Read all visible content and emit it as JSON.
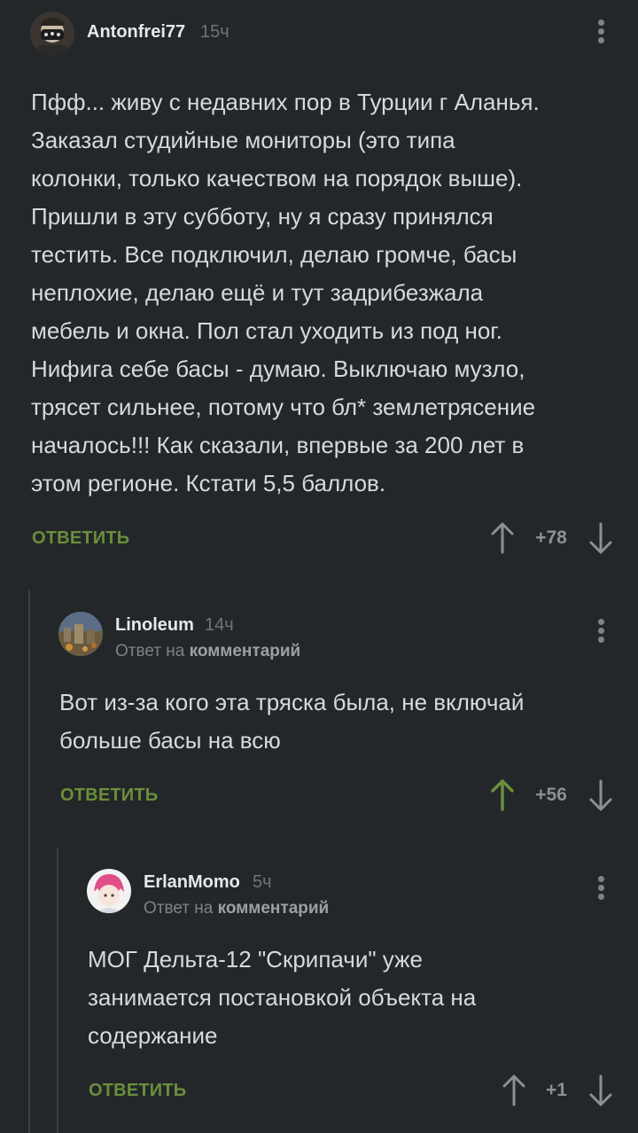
{
  "comments": [
    {
      "author": "Antonfrei77",
      "time": "15ч",
      "lines": [
        "Пфф... живу с недавних пор в Турции г Аланья.",
        "Заказал студийные мониторы (это типа",
        "колонки, только качеством на порядок выше).",
        "Пришли в эту субботу, ну я сразу принялся",
        "тестить. Все подключил, делаю громче, басы",
        "неплохие, делаю ещё и тут задрибезжала",
        "мебель и окна. Пол стал уходить из под ног.",
        "Нифига себе басы - думаю. Выключаю музло,",
        "трясет сильнее, потому что бл* землетрясение",
        "началось!!! Как сказали, впервые за 200 лет в",
        "этом регионе. Кстати 5,5 баллов."
      ],
      "reply_label": "ОТВЕТИТЬ",
      "rating": "+78",
      "upvoted": false
    },
    {
      "author": "Linoleum",
      "time": "14ч",
      "reply_prefix": "Ответ на",
      "reply_target": "комментарий",
      "lines": [
        "Вот из-за кого эта тряска была, не включай",
        "больше басы на всю"
      ],
      "reply_label": "ОТВЕТИТЬ",
      "rating": "+56",
      "upvoted": true
    },
    {
      "author": "ErlanMomo",
      "time": "5ч",
      "reply_prefix": "Ответ на",
      "reply_target": "комментарий",
      "lines": [
        "МОГ Дельта-12 \"Скрипачи\" уже",
        "занимается постановкой объекта на",
        "содержание"
      ],
      "reply_label": "ОТВЕТИТЬ",
      "rating": "+1",
      "upvoted": false
    }
  ],
  "colors": {
    "background": "#232729",
    "accent_green": "#6b8e3c",
    "text": "#d7d9db",
    "muted": "#6f7578"
  },
  "icons": {
    "upvote": "arrow-up-icon",
    "downvote": "arrow-down-icon",
    "menu": "more-vertical-icon"
  }
}
